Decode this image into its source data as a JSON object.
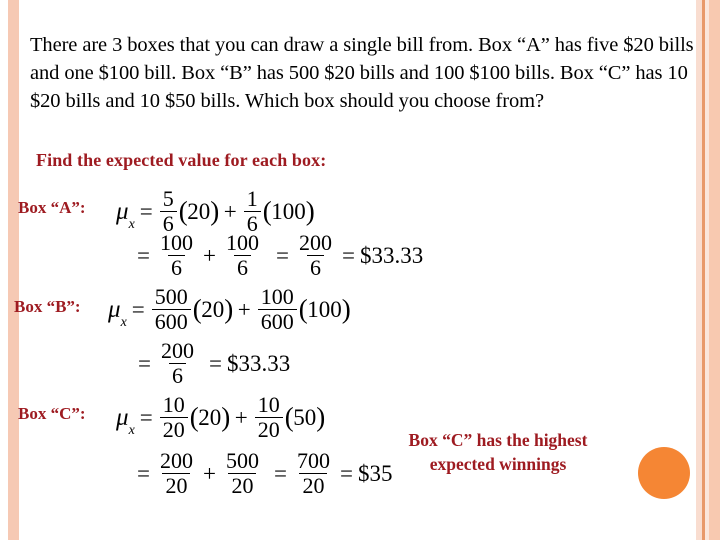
{
  "slide": {
    "prompt": "There are 3 boxes that you can draw a single bill from.  Box “A” has five $20 bills and one $100 bill.  Box “B” has 500 $20 bills and 100 $100 bills.  Box “C” has 10 $20 bills and 10 $50 bills.  Which box should you choose from?",
    "instruction": "Find the expected value for each box:",
    "conclusion_line1": "Box “C” has the highest",
    "conclusion_line2": "expected winnings"
  },
  "labels": {
    "box_a": "Box “A”:",
    "box_b": "Box “B”:",
    "box_c": "Box “C”:"
  },
  "symbols": {
    "mu": "μ",
    "sub_x": "x",
    "equals": "=",
    "plus": "+",
    "lparen": "(",
    "rparen": ")"
  },
  "box_a": {
    "line1": {
      "f1_num": "5",
      "f1_den": "6",
      "t1": "20",
      "f2_num": "1",
      "f2_den": "6",
      "t2": "100"
    },
    "line2": {
      "f1_num": "100",
      "f1_den": "6",
      "f2_num": "100",
      "f2_den": "6",
      "f3_num": "200",
      "f3_den": "6",
      "result": "$33.33"
    }
  },
  "box_b": {
    "line1": {
      "f1_num": "500",
      "f1_den": "600",
      "t1": "20",
      "f2_num": "100",
      "f2_den": "600",
      "t2": "100"
    },
    "line2": {
      "f1_num": "200",
      "f1_den": "6",
      "result": "$33.33"
    }
  },
  "box_c": {
    "line1": {
      "f1_num": "10",
      "f1_den": "20",
      "t1": "20",
      "f2_num": "10",
      "f2_den": "20",
      "t2": "50"
    },
    "line2": {
      "f1_num": "200",
      "f1_den": "20",
      "f2_num": "500",
      "f2_den": "20",
      "f3_num": "700",
      "f3_den": "20",
      "result": "$35"
    }
  },
  "colors": {
    "accent_red": "#9e1b21",
    "accent_orange": "#f58634",
    "border_salmon": "#f6c9b4"
  }
}
